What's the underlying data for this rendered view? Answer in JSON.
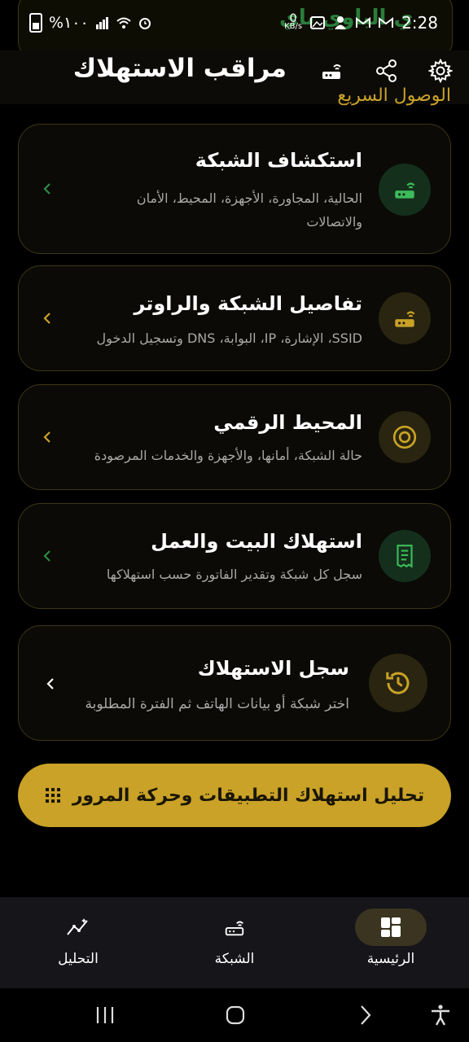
{
  "status_bar": {
    "battery_text": "%١٠٠",
    "time": "2:28",
    "kbs_value": "0",
    "kbs_unit": "KB/s",
    "toast_text": "ي الباوي باي"
  },
  "header": {
    "title": "مراقب الاستهلاك",
    "quick_access": "الوصول السريع"
  },
  "cards": [
    {
      "title": "استكشاف الشبكة",
      "desc": "الحالية، المجاورة، الأجهزة، المحيط، الأمان والاتصالات",
      "icon": "router-icon"
    },
    {
      "title": "تفاصيل الشبكة والراوتر",
      "desc": "SSID، الإشارة، IP، البوابة، DNS وتسجيل الدخول",
      "icon": "router-icon"
    },
    {
      "title": "المحيط الرقمي",
      "desc": "حالة الشبكة، أمانها، والأجهزة والخدمات المرصودة",
      "icon": "at-sign-icon"
    },
    {
      "title": "استهلاك البيت والعمل",
      "desc": "سجل كل شبكة وتقدير الفاتورة حسب استهلاكها",
      "icon": "receipt-icon"
    },
    {
      "title": "سجل الاستهلاك",
      "desc": "اختر شبكة أو بيانات الهاتف ثم الفترة المطلوبة",
      "icon": "history-icon"
    }
  ],
  "cta": {
    "label": "تحليل استهلاك التطبيقات وحركة المرور"
  },
  "bottom_nav": {
    "home": "الرئيسية",
    "network": "الشبكة",
    "analysis": "التحليل"
  },
  "colors": {
    "accent": "#c9a227",
    "card_border": "#3d3616",
    "green_chevron": "#2f8a42"
  }
}
